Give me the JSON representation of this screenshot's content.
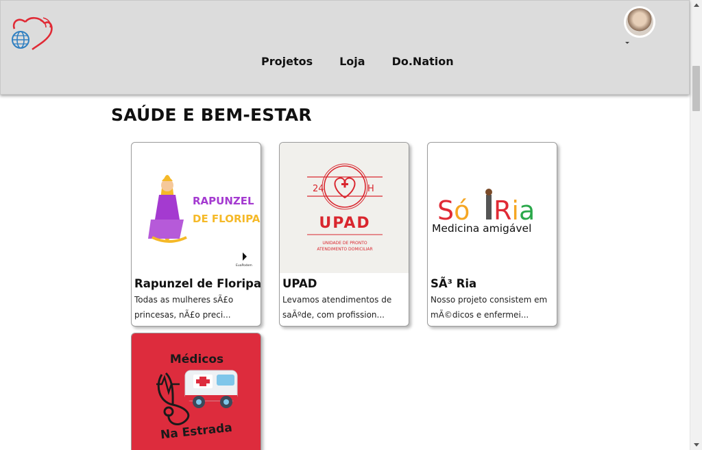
{
  "header": {
    "nav": [
      "Projetos",
      "Loja",
      "Do.Nation"
    ]
  },
  "section": {
    "title": "SAÚDE E BEM-ESTAR"
  },
  "cards": [
    {
      "name": "Rapunzel de Floripa",
      "description": "Todas as mulheres sÃ£o princesas, nÃ£o preci...",
      "image_text": [
        "RAPUNZEL",
        "DE FLORIPA",
        "EuaPodem"
      ]
    },
    {
      "name": "UPAD",
      "description": "Levamos atendimentos de saÃºde, com profission...",
      "image_text": [
        "24",
        "H",
        "UPAD",
        "UNIDADE DE PRONTO",
        "ATENDIMENTO DOMICILIAR"
      ]
    },
    {
      "name": "SÃ³ Ria",
      "description": "Nosso projeto consistem em mÃ©dicos e enfermei...",
      "image_text": [
        "Só",
        "Ria",
        "Medicina amigável"
      ]
    },
    {
      "name": "",
      "description": "",
      "image_text": [
        "Médicos",
        "Na Estrada"
      ]
    }
  ],
  "colors": {
    "header_bg": "#dcdcdc",
    "brand_red": "#d9262e",
    "card4_bg": "#dd2c3d",
    "rapunzel_text": "#a43ad0",
    "rapunzel_accent": "#f5b928"
  },
  "icons": {
    "logo": "heart-globe-logo",
    "avatar": "user-avatar",
    "avatar_menu": "caret-down-icon"
  }
}
